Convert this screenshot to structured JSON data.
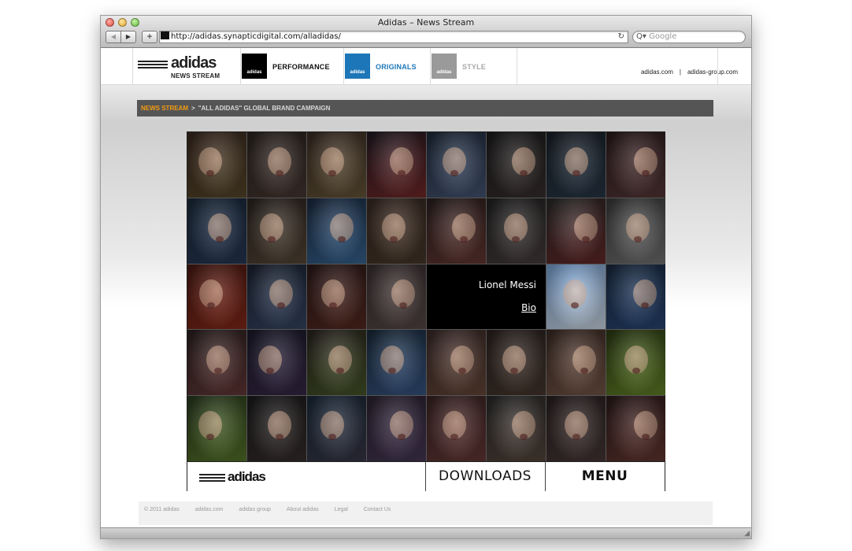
{
  "window": {
    "title": "Adidas – News Stream",
    "url": "http://adidas.synapticdigital.com/alladidas/",
    "search_placeholder": "Google",
    "back_glyph": "◀",
    "forward_glyph": "▶",
    "add_glyph": "+",
    "reload_glyph": "↻",
    "search_glyph": "Q▾"
  },
  "header": {
    "logo_word": "adidas",
    "logo_sub": "NEWS STREAM",
    "tabs": [
      {
        "label": "PERFORMANCE",
        "color": "#111111",
        "icon": "performance-logo-icon"
      },
      {
        "label": "ORIGINALS",
        "color": "#1d76b7",
        "icon": "trefoil-logo-icon"
      },
      {
        "label": "STYLE",
        "color": "#a8a8a8",
        "icon": "style-logo-icon"
      }
    ],
    "icon_mark": "adidas",
    "links": [
      "adidas.com",
      "adidas-group.com"
    ],
    "link_sep": "|"
  },
  "breadcrumb": {
    "items": [
      "NEWS STREAM",
      "\"ALL ADIDAS\" GLOBAL BRAND CAMPAIGN"
    ],
    "sep": ">",
    "accent": "#f39c12"
  },
  "feature": {
    "name": "Lionel Messi",
    "link": "Bio"
  },
  "wall_footer": {
    "logo_word": "adidas",
    "downloads": "DOWNLOADS",
    "menu": "MENU"
  },
  "footer": {
    "links": [
      "© 2011 adidas",
      "adidas.com",
      "adidas group",
      "About adidas",
      "Legal",
      "Contact Us"
    ]
  }
}
